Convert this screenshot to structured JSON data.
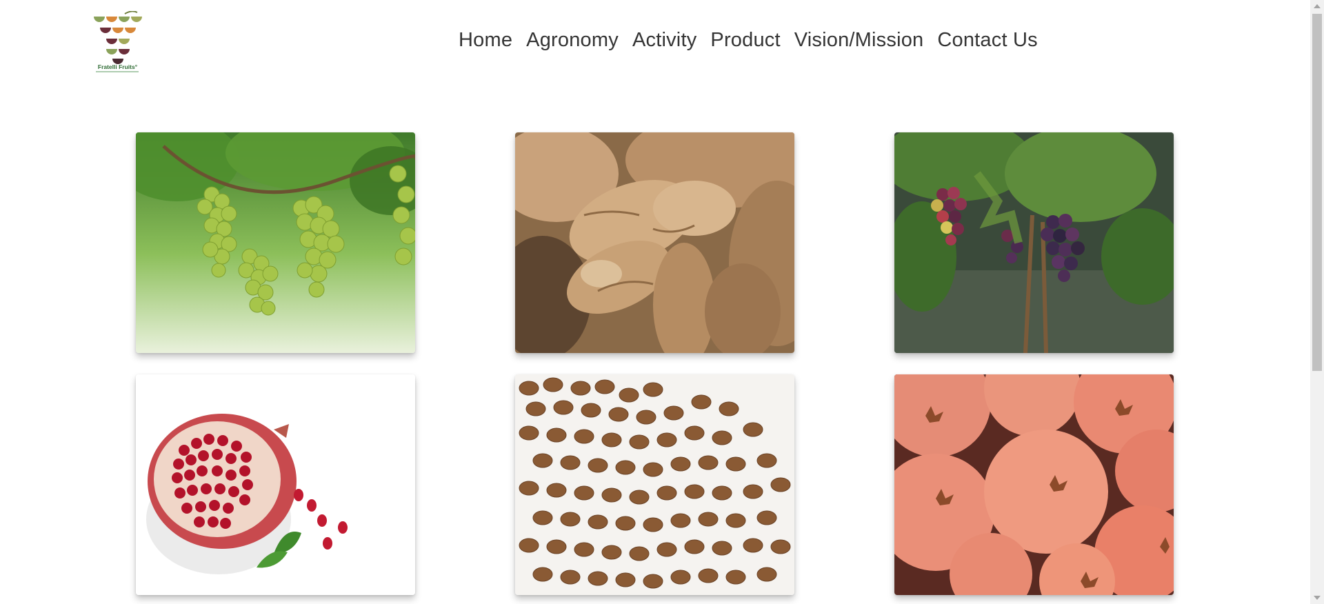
{
  "brand": {
    "name": "Fratelli Fruits°",
    "logo_colors": [
      "#8aa25a",
      "#d8883a",
      "#6b2e3a",
      "#a2a95a",
      "#4a2a32"
    ]
  },
  "nav": {
    "items": [
      {
        "label": "Home"
      },
      {
        "label": "Agronomy"
      },
      {
        "label": "Activity"
      },
      {
        "label": "Product"
      },
      {
        "label": "Vision/Mission"
      },
      {
        "label": "Contact Us"
      }
    ]
  },
  "products": [
    {
      "subject": "green-grapes-on-vine"
    },
    {
      "subject": "ginger-root"
    },
    {
      "subject": "red-grapes-on-vine"
    },
    {
      "subject": "pomegranate-half"
    },
    {
      "subject": "chocolate-coated-raisins"
    },
    {
      "subject": "pomegranates"
    }
  ]
}
